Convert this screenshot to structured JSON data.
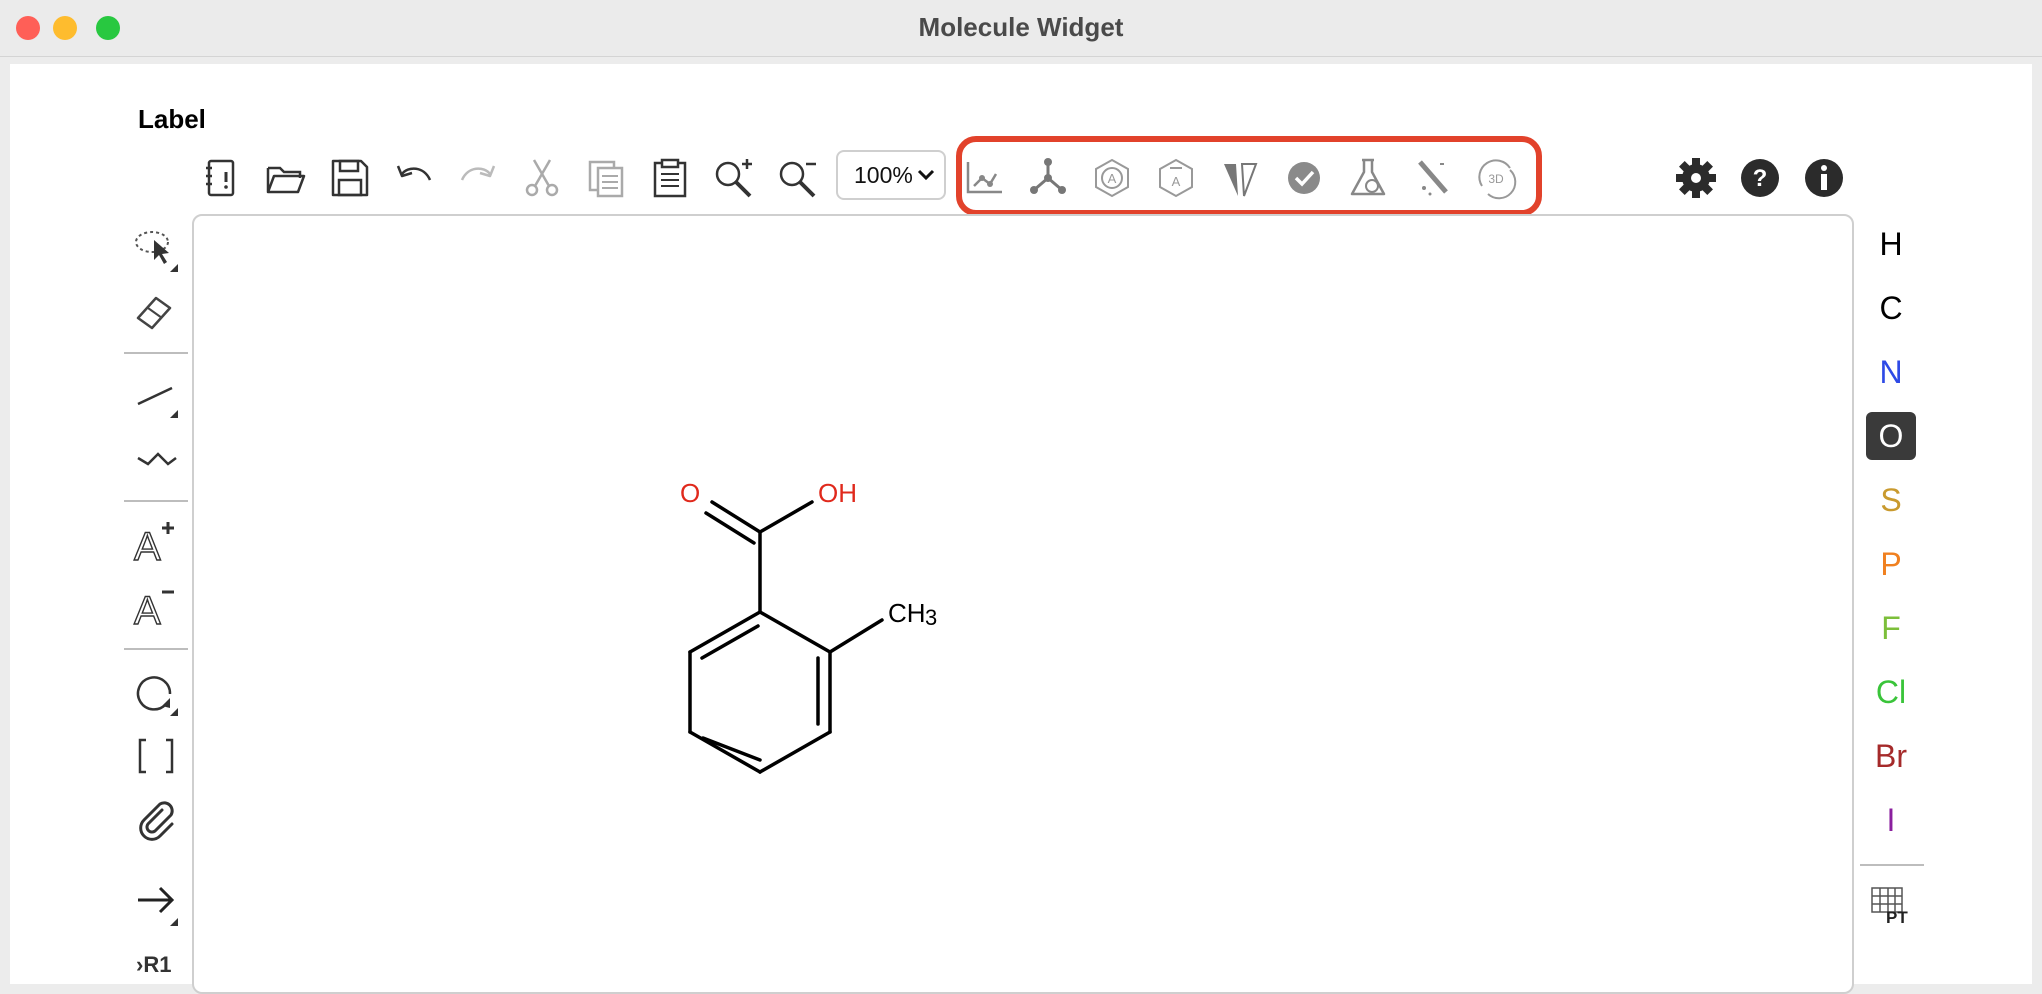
{
  "window": {
    "title": "Molecule Widget",
    "traffic_lights": [
      "#ff5f57",
      "#febc2e",
      "#28c840"
    ]
  },
  "widget": {
    "label": "Label"
  },
  "toolbar": {
    "file_items": [
      "new-document-icon",
      "open-folder-icon",
      "save-icon",
      "undo-icon",
      "redo-icon",
      "cut-icon",
      "copy-icon",
      "paste-icon",
      "zoom-in-icon",
      "zoom-out-icon"
    ],
    "zoom_value": "100%",
    "chemistry_items": [
      "clean-2d-icon",
      "clean-3d-icon",
      "aromatize-icon",
      "dearomatize-icon",
      "stereo-icon",
      "check-structure-icon",
      "calculate-icon",
      "highlight-icon",
      "3d-view-icon"
    ],
    "highlight_color": "#e2422b",
    "settings_items": [
      "settings-icon",
      "help-icon",
      "about-icon"
    ]
  },
  "left_toolbar": {
    "items": [
      "select-lasso-icon",
      "eraser-icon",
      "single-bond-icon",
      "chain-icon",
      "charge-plus-icon",
      "charge-minus-icon",
      "ring-rotate-icon",
      "brackets-icon",
      "attachment-icon",
      "reaction-arrow-icon",
      "rgroup-icon"
    ],
    "rgroup_label": "›R1"
  },
  "molecule": {
    "atoms": {
      "o_carbonyl": "O",
      "hydroxyl": "OH",
      "methyl": "CH",
      "methyl_sub": "3"
    },
    "heteroatom_color": "#e0291c",
    "bond_color": "#000000"
  },
  "elements": {
    "items": [
      {
        "symbol": "H",
        "color": "#000000"
      },
      {
        "symbol": "C",
        "color": "#000000"
      },
      {
        "symbol": "N",
        "color": "#2e4ae6"
      },
      {
        "symbol": "O",
        "color": "#ffffff",
        "selected": true
      },
      {
        "symbol": "S",
        "color": "#c99a2e"
      },
      {
        "symbol": "P",
        "color": "#f08020"
      },
      {
        "symbol": "F",
        "color": "#7cbf3a"
      },
      {
        "symbol": "Cl",
        "color": "#3ac43a"
      },
      {
        "symbol": "Br",
        "color": "#a52a2a"
      },
      {
        "symbol": "I",
        "color": "#8a1f9e"
      }
    ],
    "selected_bg": "#3a3a3a",
    "periodic_table_label": "PT"
  }
}
